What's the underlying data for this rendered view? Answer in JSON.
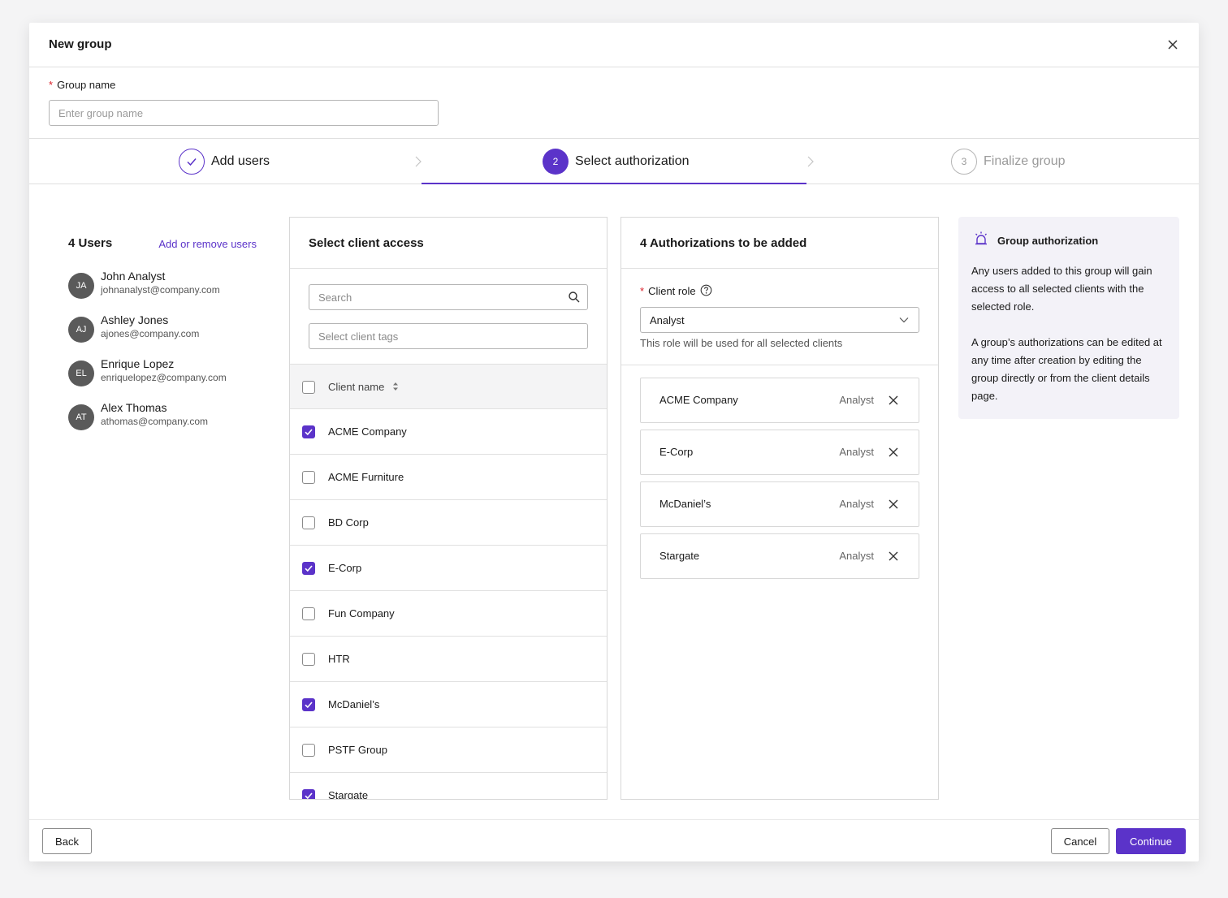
{
  "modal": {
    "title": "New group"
  },
  "group_name": {
    "label": "Group name",
    "required_mark": "*",
    "placeholder": "Enter group name",
    "value": ""
  },
  "stepper": {
    "steps": [
      {
        "number": "1",
        "label": "Add users",
        "state": "complete"
      },
      {
        "number": "2",
        "label": "Select authorization",
        "state": "active"
      },
      {
        "number": "3",
        "label": "Finalize group",
        "state": "upcoming"
      }
    ]
  },
  "users": {
    "count_label": "4 Users",
    "link_label": "Add or remove users",
    "list": [
      {
        "initials": "JA",
        "name": "John Analyst",
        "email": "johnanalyst@company.com"
      },
      {
        "initials": "AJ",
        "name": "Ashley Jones",
        "email": "ajones@company.com"
      },
      {
        "initials": "EL",
        "name": "Enrique Lopez",
        "email": "enriquelopez@company.com"
      },
      {
        "initials": "AT",
        "name": "Alex Thomas",
        "email": "athomas@company.com"
      }
    ]
  },
  "client_access": {
    "title": "Select client access",
    "search_placeholder": "Search",
    "tags_placeholder": "Select client tags",
    "column_header": "Client name",
    "rows": [
      {
        "name": "ACME Company",
        "checked": true
      },
      {
        "name": "ACME Furniture",
        "checked": false
      },
      {
        "name": "BD Corp",
        "checked": false
      },
      {
        "name": "E-Corp",
        "checked": true
      },
      {
        "name": "Fun Company",
        "checked": false
      },
      {
        "name": "HTR",
        "checked": false
      },
      {
        "name": "McDaniel’s",
        "checked": true
      },
      {
        "name": "PSTF Group",
        "checked": false
      },
      {
        "name": "Stargate",
        "checked": true
      }
    ]
  },
  "authorizations": {
    "title": "4 Authorizations to be added",
    "role_label": "Client role",
    "required_mark": "*",
    "role_value": "Analyst",
    "role_help": "This role will be used for all selected clients",
    "items": [
      {
        "name": "ACME Company",
        "role": "Analyst"
      },
      {
        "name": "E-Corp",
        "role": "Analyst"
      },
      {
        "name": "McDaniel’s",
        "role": "Analyst"
      },
      {
        "name": "Stargate",
        "role": "Analyst"
      }
    ]
  },
  "info": {
    "title": "Group authorization",
    "paragraph_1": "Any users added to this group will gain access to all selected clients with the selected role.",
    "paragraph_2": "A group’s authorizations can be edited at any time after creation by editing the group directly or from the client details page."
  },
  "footer": {
    "back_label": "Back",
    "cancel_label": "Cancel",
    "continue_label": "Continue"
  },
  "colors": {
    "accent": "#5b33c9",
    "required": "#da1e28",
    "avatar": "#5a5a5a",
    "info_bg": "#f3f2f8"
  }
}
